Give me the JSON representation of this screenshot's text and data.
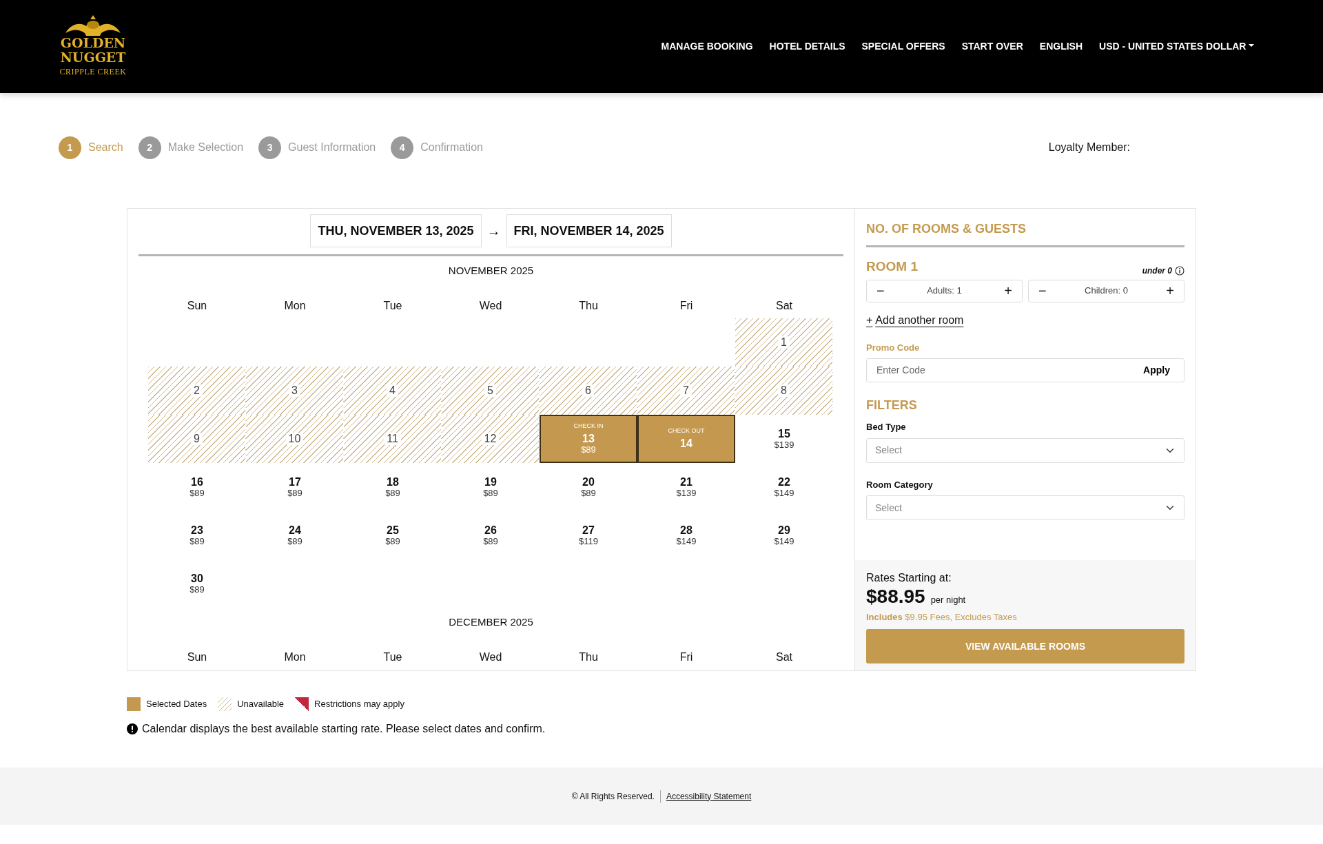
{
  "header": {
    "logo": {
      "name": "GOLDEN NUGGET",
      "subtitle": "CRIPPLE CREEK"
    },
    "nav": [
      {
        "label": "MANAGE BOOKING",
        "kind": "link"
      },
      {
        "label": "HOTEL DETAILS",
        "kind": "link"
      },
      {
        "label": "SPECIAL OFFERS",
        "kind": "link"
      },
      {
        "label": "START OVER",
        "kind": "link"
      },
      {
        "label": "ENGLISH",
        "kind": "link"
      },
      {
        "label": "USD - UNITED STATES DOLLAR",
        "kind": "dropdown"
      }
    ]
  },
  "steps": [
    {
      "number": "1",
      "label": "Search",
      "selected": true
    },
    {
      "number": "2",
      "label": "Make Selection",
      "selected": false
    },
    {
      "number": "3",
      "label": "Guest Information",
      "selected": false
    },
    {
      "number": "4",
      "label": "Confirmation",
      "selected": false
    }
  ],
  "loyalty": "Loyalty Member:",
  "dates": {
    "check_in": "THU, NOVEMBER 13, 2025",
    "arrow": "→",
    "check_out": "FRI, NOVEMBER 14, 2025"
  },
  "months": [
    {
      "title": "NOVEMBER 2025",
      "weekdays": [
        "Sun",
        "Mon",
        "Tue",
        "Wed",
        "Thu",
        "Fri",
        "Sat"
      ],
      "days": [
        {
          "kind": "blank"
        },
        {
          "kind": "blank"
        },
        {
          "kind": "blank"
        },
        {
          "kind": "blank"
        },
        {
          "kind": "blank"
        },
        {
          "kind": "blank"
        },
        {
          "kind": "unavailable",
          "day": "1"
        },
        {
          "kind": "unavailable",
          "day": "2"
        },
        {
          "kind": "unavailable",
          "day": "3"
        },
        {
          "kind": "unavailable",
          "day": "4"
        },
        {
          "kind": "unavailable",
          "day": "5"
        },
        {
          "kind": "unavailable",
          "day": "6"
        },
        {
          "kind": "unavailable",
          "day": "7"
        },
        {
          "kind": "unavailable",
          "day": "8"
        },
        {
          "kind": "unavailable",
          "day": "9"
        },
        {
          "kind": "unavailable",
          "day": "10"
        },
        {
          "kind": "unavailable",
          "day": "11"
        },
        {
          "kind": "unavailable",
          "day": "12"
        },
        {
          "kind": "selected",
          "tag": "CHECK IN",
          "day": "13",
          "price": "$89"
        },
        {
          "kind": "selected",
          "tag": "CHECK OUT",
          "day": "14"
        },
        {
          "kind": "available",
          "day": "15",
          "price": "$139"
        },
        {
          "kind": "available",
          "day": "16",
          "price": "$89"
        },
        {
          "kind": "available",
          "day": "17",
          "price": "$89"
        },
        {
          "kind": "available",
          "day": "18",
          "price": "$89"
        },
        {
          "kind": "available",
          "day": "19",
          "price": "$89"
        },
        {
          "kind": "available",
          "day": "20",
          "price": "$89"
        },
        {
          "kind": "available",
          "day": "21",
          "price": "$139"
        },
        {
          "kind": "available",
          "day": "22",
          "price": "$149"
        },
        {
          "kind": "available",
          "day": "23",
          "price": "$89"
        },
        {
          "kind": "available",
          "day": "24",
          "price": "$89"
        },
        {
          "kind": "available",
          "day": "25",
          "price": "$89"
        },
        {
          "kind": "available",
          "day": "26",
          "price": "$89"
        },
        {
          "kind": "available",
          "day": "27",
          "price": "$119"
        },
        {
          "kind": "available",
          "day": "28",
          "price": "$149"
        },
        {
          "kind": "available",
          "day": "29",
          "price": "$149"
        },
        {
          "kind": "available",
          "day": "30",
          "price": "$89"
        }
      ]
    },
    {
      "title": "DECEMBER 2025",
      "weekdays": [
        "Sun",
        "Mon",
        "Tue",
        "Wed",
        "Thu",
        "Fri",
        "Sat"
      ]
    }
  ],
  "guests": {
    "title": "NO. OF ROOMS & GUESTS",
    "room_title": "ROOM 1",
    "age_hint": "under 0",
    "counters": [
      {
        "minus": "−",
        "label": "Adults: 1",
        "plus": "+"
      },
      {
        "minus": "−",
        "label": "Children: 0",
        "plus": "+"
      }
    ],
    "add_room": {
      "icon": "+",
      "label": "Add another room"
    },
    "promo": {
      "label": "Promo Code",
      "placeholder": "Enter Code",
      "button": "Apply"
    }
  },
  "filters": {
    "title": "FILTERS",
    "selects": [
      {
        "label": "Bed Type",
        "placeholder": "Select"
      },
      {
        "label": "Room Category",
        "placeholder": "Select"
      }
    ]
  },
  "rates": {
    "label": "Rates Starting at:",
    "price": "$88.95",
    "unit": "per night",
    "note": "**Includes** $9.95 Fees, Excludes Taxes",
    "button": "VIEW AVAILABLE ROOMS"
  },
  "legend": [
    {
      "kind": "selected",
      "label": "Selected Dates"
    },
    {
      "kind": "unavailable",
      "label": "Unavailable"
    },
    {
      "kind": "restricted",
      "label": "Restrictions may apply"
    }
  ],
  "note": "Calendar displays the best available starting rate. Please select dates and confirm.",
  "footer": {
    "copyright": "© All Rights Reserved.",
    "link": "Accessibility Statement"
  }
}
